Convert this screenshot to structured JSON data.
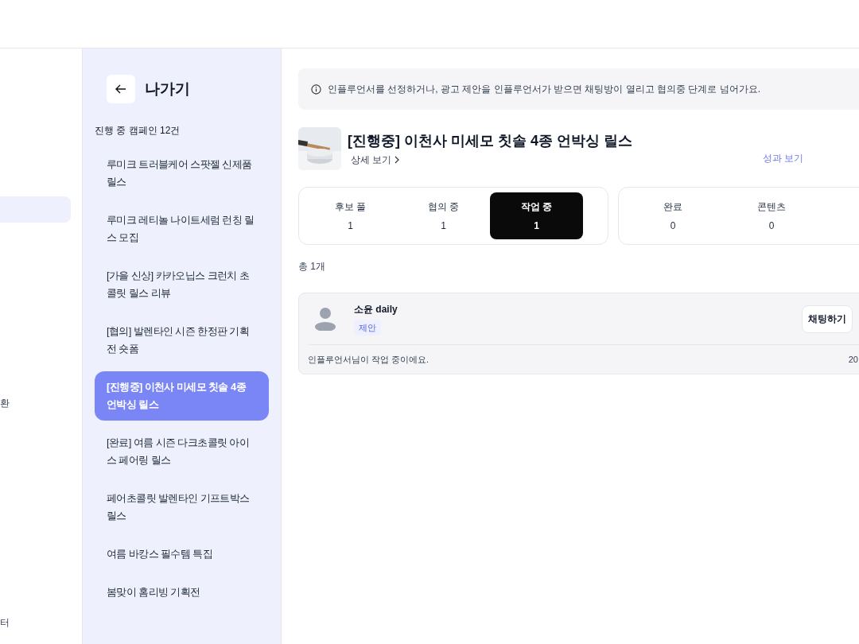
{
  "left_nav": {
    "items": [
      {
        "selected": true
      },
      {
        "label": "환",
        "selected": false
      },
      {
        "label": "터",
        "selected": false
      }
    ]
  },
  "campaign_panel": {
    "back_label": "나가기",
    "count_label": "진행 중 캠페인 12건",
    "items": [
      {
        "label": "루미크 트러블케어 스팟젤 신제품 릴스",
        "selected": false
      },
      {
        "label": "루미크 레티놀 나이트세럼 런칭 릴스 모집",
        "selected": false
      },
      {
        "label": "[가을 신상] 카카오닙스 크런치 초콜릿 릴스 리뷰",
        "selected": false
      },
      {
        "label": "[협의] 발렌타인 시즌 한정판 기획전 숏폼",
        "selected": false
      },
      {
        "label": "[진행중] 이천사 미세모 칫솔 4종 언박싱 릴스",
        "selected": true
      },
      {
        "label": "[완료] 여름 시즌 다크초콜릿 아이스 페어링 릴스",
        "selected": false
      },
      {
        "label": "페어초콜릿 발렌타인 기프트박스 릴스",
        "selected": false
      },
      {
        "label": "여름 바캉스 필수템 특집",
        "selected": false
      },
      {
        "label": "봄맞이 홈리빙 기획전",
        "selected": false
      }
    ]
  },
  "notice": "인플루언서를 선정하거나, 광고 제안을 인플루언서가 받으면 채팅방이 열리고 협의중 단계로 넘어가요.",
  "campaign": {
    "title": "[진행중] 이천사 미세모 칫솔 4종 언박싱 릴스",
    "detail_link": "상세 보기",
    "performance_link": "성과 보기"
  },
  "stage_groups": [
    [
      {
        "label": "후보 풀",
        "count": "1",
        "selected": false
      },
      {
        "label": "협의 중",
        "count": "1",
        "selected": false
      },
      {
        "label": "작업 중",
        "count": "1",
        "selected": true
      }
    ],
    [
      {
        "label": "완료",
        "count": "0",
        "selected": false
      },
      {
        "label": "콘텐츠",
        "count": "0",
        "selected": false
      }
    ]
  ],
  "total": "총 1개",
  "influencers": [
    {
      "name": "소윤 daily",
      "tag": "제안",
      "button": "채팅하기",
      "status": "인플루언서님이 작업 중이에요.",
      "date": "20"
    }
  ]
}
